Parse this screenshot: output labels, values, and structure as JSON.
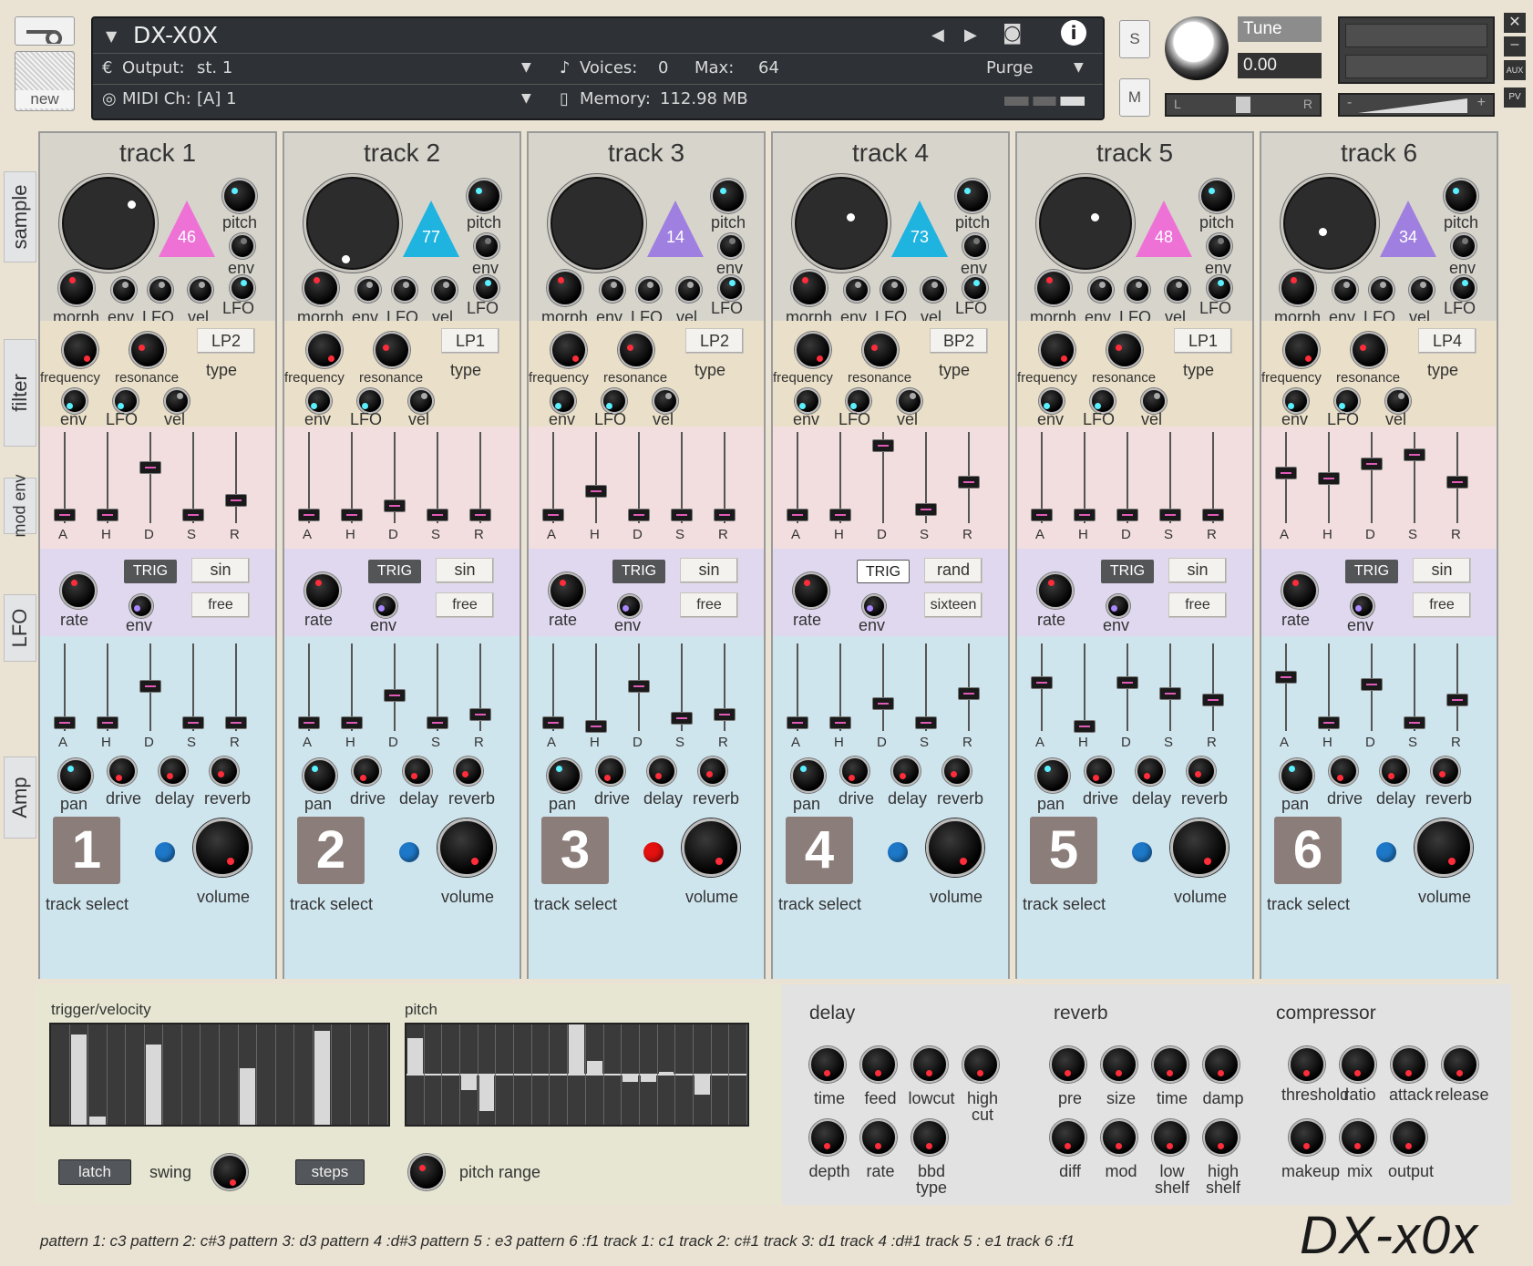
{
  "header": {
    "instrument_name": "DX-X0X",
    "output_label": "Output:",
    "output_value": "st. 1",
    "midi_label": "MIDI Ch:",
    "midi_value": "[A]  1",
    "voices_label": "Voices:",
    "voices_value": "0",
    "max_label": "Max:",
    "max_value": "64",
    "memory_label": "Memory:",
    "memory_value": "112.98 MB",
    "purge": "Purge",
    "new": "new",
    "solo": "S",
    "mute": "M",
    "tune_label": "Tune",
    "tune_value": "0.00",
    "pan_l": "L",
    "pan_r": "R",
    "vol_minus": "-",
    "vol_plus": "+",
    "aux": "AUX",
    "pv": "PV"
  },
  "side_tabs": [
    "sample",
    "filter",
    "mod env",
    "LFO",
    "Amp"
  ],
  "labels": {
    "pitch": "pitch",
    "env": "env",
    "lfo": "LFO",
    "morph": "morph",
    "vel": "vel",
    "frequency": "frequency",
    "resonance": "resonance",
    "type": "type",
    "A": "A",
    "H": "H",
    "D": "D",
    "S": "S",
    "R": "R",
    "rate": "rate",
    "trig": "TRIG",
    "pan": "pan",
    "drive": "drive",
    "delay": "delay",
    "reverb": "reverb",
    "track_select": "track select",
    "volume": "volume"
  },
  "tracks": [
    {
      "title": "track 1",
      "sample_num": "46",
      "sample_color": "#ee72d6",
      "filter_type": "LP2",
      "lfo_wave": "sin",
      "lfo_mode": "free",
      "select": "1",
      "led": "#1e78c8",
      "modenv": [
        0.1,
        0.1,
        0.62,
        0.1,
        0.26
      ],
      "ampenv": [
        0.1,
        0.1,
        0.52,
        0.1,
        0.1
      ]
    },
    {
      "title": "track 2",
      "sample_num": "77",
      "sample_color": "#1fb3e0",
      "filter_type": "LP1",
      "lfo_wave": "sin",
      "lfo_mode": "free",
      "select": "2",
      "led": "#1e78c8",
      "modenv": [
        0.1,
        0.1,
        0.2,
        0.1,
        0.1
      ],
      "ampenv": [
        0.1,
        0.1,
        0.42,
        0.1,
        0.2
      ]
    },
    {
      "title": "track 3",
      "sample_num": "14",
      "sample_color": "#9f80e0",
      "filter_type": "LP2",
      "lfo_wave": "sin",
      "lfo_mode": "free",
      "select": "3",
      "led": "#e51010",
      "modenv": [
        0.1,
        0.36,
        0.1,
        0.1,
        0.1
      ],
      "ampenv": [
        0.1,
        0.06,
        0.52,
        0.16,
        0.2
      ]
    },
    {
      "title": "track 4",
      "sample_num": "73",
      "sample_color": "#1fb3e0",
      "filter_type": "BP2",
      "lfo_wave": "rand",
      "lfo_mode": "sixteen",
      "select": "4",
      "led": "#1e78c8",
      "modenv": [
        0.1,
        0.1,
        0.86,
        0.16,
        0.46
      ],
      "ampenv": [
        0.1,
        0.1,
        0.32,
        0.1,
        0.44
      ]
    },
    {
      "title": "track 5",
      "sample_num": "48",
      "sample_color": "#ee72d6",
      "filter_type": "LP1",
      "lfo_wave": "sin",
      "lfo_mode": "free",
      "select": "5",
      "led": "#1e78c8",
      "modenv": [
        0.1,
        0.1,
        0.1,
        0.1,
        0.1
      ],
      "ampenv": [
        0.56,
        0.06,
        0.56,
        0.44,
        0.36
      ]
    },
    {
      "title": "track 6",
      "sample_num": "34",
      "sample_color": "#9f80e0",
      "filter_type": "LP4",
      "lfo_wave": "sin",
      "lfo_mode": "free",
      "select": "6",
      "led": "#1e78c8",
      "modenv": [
        0.56,
        0.5,
        0.66,
        0.76,
        0.46
      ],
      "ampenv": [
        0.62,
        0.1,
        0.54,
        0.1,
        0.36
      ]
    }
  ],
  "sequencer": {
    "trigger_label": "trigger/velocity",
    "pitch_label": "pitch",
    "velocity_steps": [
      0,
      0.9,
      0.08,
      0,
      0,
      0.8,
      0,
      0,
      0,
      0,
      0.56,
      0,
      0,
      0,
      0.94,
      0,
      0,
      0
    ],
    "pitch_steps": [
      0.36,
      0,
      0,
      -0.15,
      -0.36,
      0,
      0,
      0,
      0,
      0.5,
      0.14,
      0,
      -0.07,
      -0.07,
      0.03,
      0,
      -0.2,
      0,
      0
    ],
    "latch": "latch",
    "swing": "swing",
    "steps": "steps",
    "pitch_range": "pitch range"
  },
  "fx": {
    "delay_title": "delay",
    "reverb_title": "reverb",
    "compressor_title": "compressor",
    "delay_row1": [
      "time",
      "feed",
      "lowcut",
      "high cut"
    ],
    "delay_row2": [
      "depth",
      "rate",
      "bbd type"
    ],
    "reverb_row1": [
      "pre",
      "size",
      "time",
      "damp"
    ],
    "reverb_row2": [
      "diff",
      "mod",
      "low shelf",
      "high shelf"
    ],
    "comp_row1": [
      "threshold",
      "ratio",
      "attack",
      "release"
    ],
    "comp_row2": [
      "makeup",
      "mix",
      "output"
    ]
  },
  "footer": {
    "mapping": "pattern 1: c3  pattern 2: c#3  pattern 3: d3 pattern 4 :d#3 pattern 5 : e3 pattern 6 :f1   track 1: c1  track 2: c#1  track 3: d1 track 4 :d#1 track 5 : e1 track 6 :f1",
    "logo": "DX-x0x"
  },
  "colors": {
    "sample_bg": "#d7d4cc",
    "filter_bg": "#eadfc8",
    "modenv_bg": "#f2dede",
    "lfo_bg": "#e0d8ef",
    "amp_bg": "#cfe5ee",
    "seq_bg": "#e6e6d2",
    "fx_bg": "#e2e2e2"
  }
}
